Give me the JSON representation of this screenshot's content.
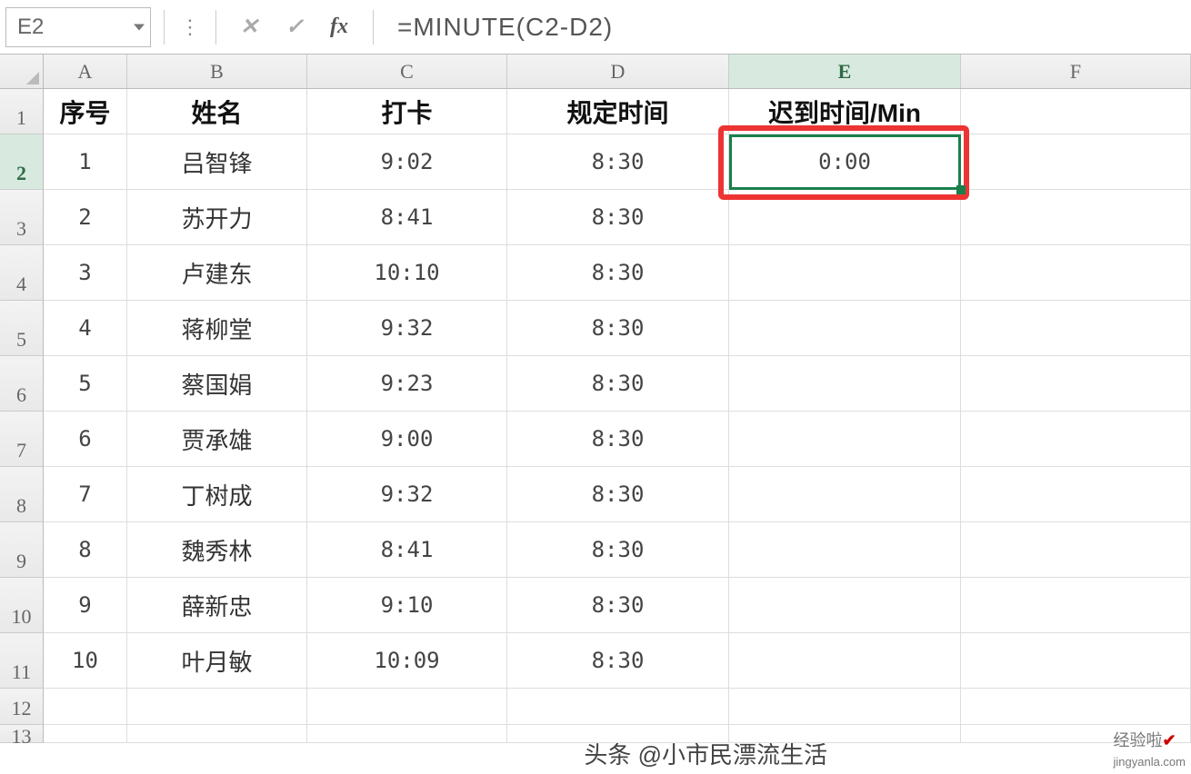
{
  "formula_bar": {
    "cell_ref": "E2",
    "formula": "=MINUTE(C2-D2)",
    "fx_label": "fx"
  },
  "columns": [
    "A",
    "B",
    "C",
    "D",
    "E",
    "F"
  ],
  "row_numbers": [
    "1",
    "2",
    "3",
    "4",
    "5",
    "6",
    "7",
    "8",
    "9",
    "10",
    "11",
    "12",
    "13"
  ],
  "headers": {
    "A": "序号",
    "B": "姓名",
    "C": "打卡",
    "D": "规定时间",
    "E": "迟到时间/Min"
  },
  "data": [
    {
      "no": "1",
      "name": "吕智锋",
      "check": "9:02",
      "std": "8:30",
      "late": "0:00"
    },
    {
      "no": "2",
      "name": "苏开力",
      "check": "8:41",
      "std": "8:30",
      "late": ""
    },
    {
      "no": "3",
      "name": "卢建东",
      "check": "10:10",
      "std": "8:30",
      "late": ""
    },
    {
      "no": "4",
      "name": "蒋柳堂",
      "check": "9:32",
      "std": "8:30",
      "late": ""
    },
    {
      "no": "5",
      "name": "蔡国娟",
      "check": "9:23",
      "std": "8:30",
      "late": ""
    },
    {
      "no": "6",
      "name": "贾承雄",
      "check": "9:00",
      "std": "8:30",
      "late": ""
    },
    {
      "no": "7",
      "name": "丁树成",
      "check": "9:32",
      "std": "8:30",
      "late": ""
    },
    {
      "no": "8",
      "name": "魏秀林",
      "check": "8:41",
      "std": "8:30",
      "late": ""
    },
    {
      "no": "9",
      "name": "薛新忠",
      "check": "9:10",
      "std": "8:30",
      "late": ""
    },
    {
      "no": "10",
      "name": "叶月敏",
      "check": "10:09",
      "std": "8:30",
      "late": ""
    }
  ],
  "selection": {
    "cell": "E2"
  },
  "watermark_left": "头条 @小市民漂流生活",
  "watermark_right_prefix": "经验啦",
  "watermark_right_mark": "✔",
  "watermark_domain": "jingyanla.com"
}
